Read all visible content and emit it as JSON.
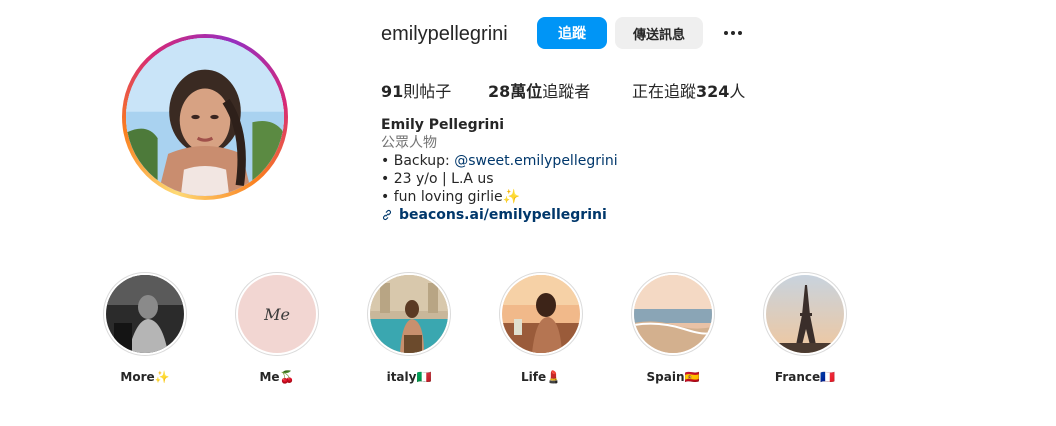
{
  "profile": {
    "username": "emilypellegrini",
    "follow_label": "追蹤",
    "message_label": "傳送訊息",
    "more_icon": "more-horizontal-icon"
  },
  "stats": {
    "posts_count": "91",
    "posts_label": "則帖子",
    "followers_count": "28萬位",
    "followers_label": "追蹤者",
    "following_prefix": "正在追蹤",
    "following_count": "324",
    "following_suffix": "人"
  },
  "bio": {
    "full_name": "Emily Pellegrini",
    "category": "公眾人物",
    "line1_prefix": "• Backup: ",
    "line1_mention": "@sweet.emilypellegrini",
    "line2": "• 23 y/o | L.A us",
    "line3": "• fun loving girlie✨",
    "link": "beacons.ai/emilypellegrini",
    "link_icon": "link-icon"
  },
  "highlights": [
    {
      "label": "More✨"
    },
    {
      "label": "Me🍒",
      "cover_text": "Me"
    },
    {
      "label": "italy🇮🇹"
    },
    {
      "label": "Life💄"
    },
    {
      "label": "Spain🇪🇸"
    },
    {
      "label": "France🇫🇷"
    }
  ],
  "colors": {
    "follow_button": "#0095f6",
    "message_button": "#efefef",
    "link": "#00376b",
    "muted": "#737373"
  }
}
